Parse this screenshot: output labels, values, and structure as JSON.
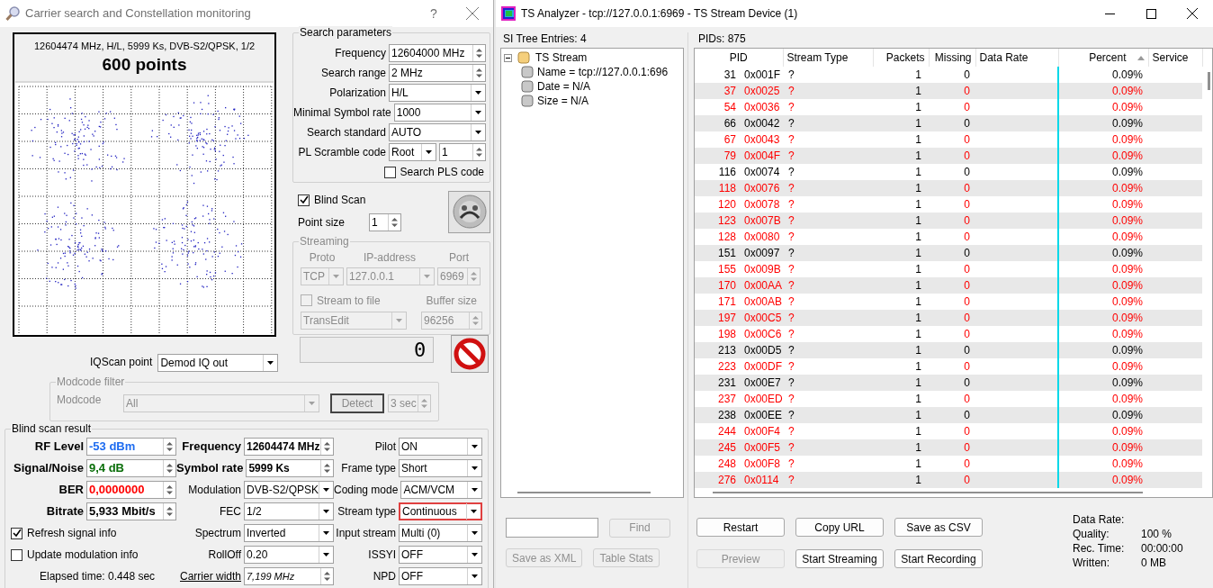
{
  "left_window": {
    "title": "Carrier search and Constellation monitoring",
    "help": "?",
    "constellation": {
      "info": "12604474 MHz, H/L, 5999 Ks, DVB-S2/QPSK, 1/2",
      "points_label": "600 points"
    },
    "search_parameters": {
      "title": "Search parameters",
      "fields": [
        {
          "label": "Frequency",
          "value": "12604000 MHz",
          "kind": "spin"
        },
        {
          "label": "Search range",
          "value": "2 MHz",
          "kind": "spin"
        },
        {
          "label": "Polarization",
          "value": "H/L",
          "kind": "combo"
        },
        {
          "label": "Minimal Symbol rate",
          "value": "1000",
          "kind": "combo"
        },
        {
          "label": "Search standard",
          "value": "AUTO",
          "kind": "combo"
        }
      ],
      "pl_scramble": {
        "label": "PL Scramble code",
        "mode": "Root",
        "value": "1"
      },
      "search_pls": {
        "label": "Search PLS code",
        "checked": false
      }
    },
    "blind_scan": {
      "label": "Blind Scan",
      "checked": true
    },
    "point_size": {
      "label": "Point size",
      "value": "1"
    },
    "streaming": {
      "title": "Streaming",
      "disabled": true,
      "proto_label": "Proto",
      "ip_label": "IP-address",
      "port_label": "Port",
      "proto": "TCP",
      "ip": "127.0.0.1",
      "port": "6969",
      "stream_to_file": {
        "label": "Stream to file",
        "checked": false
      },
      "buffer_label": "Buffer size",
      "target": "TransEdit",
      "buffer": "96256"
    },
    "counter": "0",
    "iq_scan": {
      "label": "IQScan point",
      "value": "Demod IQ out"
    },
    "modcode_filter": {
      "title": "Modcode filter",
      "disabled": true,
      "label": "Modcode",
      "value": "All",
      "detect": "Detect",
      "duration": "3 sec"
    },
    "blind_scan_result": {
      "title": "Blind scan result",
      "metrics": [
        {
          "label": "RF Level",
          "value": "-53 dBm",
          "color": "#1e6cf0"
        },
        {
          "label": "Signal/Noise",
          "value": "9,4 dB",
          "color": "#0a6e0a"
        },
        {
          "label": "BER",
          "value": "0,0000000",
          "color": "#ff0000"
        },
        {
          "label": "Bitrate",
          "value": "5,933 Mbit/s",
          "color": "#000000"
        }
      ],
      "checks": [
        {
          "label": "Refresh signal info",
          "checked": true
        },
        {
          "label": "Update modulation info",
          "checked": false
        }
      ],
      "elapsed": "Elapsed time: 0.448 sec",
      "params": [
        {
          "label": "Frequency",
          "value": "12604474 MHz",
          "kind": "bold-spin"
        },
        {
          "label": "Symbol rate",
          "value": "5999 Ks",
          "kind": "bold-spin"
        },
        {
          "label": "Modulation",
          "value": "DVB-S2/QPSK",
          "kind": "combo"
        },
        {
          "label": "FEC",
          "value": "1/2",
          "kind": "combo"
        },
        {
          "label": "Spectrum",
          "value": "Inverted",
          "kind": "combo"
        },
        {
          "label": "RollOff",
          "value": "0.20",
          "kind": "combo"
        },
        {
          "label": "Carrier width",
          "value": "7,199 MHz",
          "kind": "link-spin"
        }
      ],
      "options": [
        {
          "label": "Pilot",
          "value": "ON",
          "highlighted": false
        },
        {
          "label": "Frame type",
          "value": "Short",
          "highlighted": false
        },
        {
          "label": "Coding mode",
          "value": "ACM/VCM",
          "highlighted": false
        },
        {
          "label": "Stream type",
          "value": "Continuous",
          "highlighted": true
        },
        {
          "label": "Input stream",
          "value": "Multi (0)",
          "highlighted": false
        },
        {
          "label": "ISSYI",
          "value": "OFF",
          "highlighted": false
        },
        {
          "label": "NPD",
          "value": "OFF",
          "highlighted": false
        }
      ]
    }
  },
  "right_window": {
    "title": "TS Analyzer - tcp://127.0.0.1:6969 - TS Stream Device (1)",
    "tree": {
      "title": "SI Tree Entries: 4",
      "root": {
        "label": "TS Stream",
        "expanded": true,
        "children": [
          {
            "label": "Name = tcp://127.0.0.1:696"
          },
          {
            "label": "Date = N/A"
          },
          {
            "label": "Size = N/A"
          }
        ]
      }
    },
    "pids": {
      "title": "PIDs: 875",
      "columns": [
        {
          "label": "PID",
          "sorted": false
        },
        {
          "label": "Stream Type",
          "sorted": false
        },
        {
          "label": "Packets",
          "sorted": false
        },
        {
          "label": "Missing",
          "sorted": false
        },
        {
          "label": "Data Rate",
          "sorted": false
        },
        {
          "label": "Percent",
          "sorted": true
        },
        {
          "label": "Service",
          "sorted": false
        }
      ],
      "rows": [
        {
          "pid": "31",
          "hex": "0x001F",
          "type": "?",
          "packets": "1",
          "missing": "0",
          "percent": "0.09%",
          "error": false
        },
        {
          "pid": "37",
          "hex": "0x0025",
          "type": "?",
          "packets": "1",
          "missing": "0",
          "percent": "0.09%",
          "error": true
        },
        {
          "pid": "54",
          "hex": "0x0036",
          "type": "?",
          "packets": "1",
          "missing": "0",
          "percent": "0.09%",
          "error": true
        },
        {
          "pid": "66",
          "hex": "0x0042",
          "type": "?",
          "packets": "1",
          "missing": "0",
          "percent": "0.09%",
          "error": false
        },
        {
          "pid": "67",
          "hex": "0x0043",
          "type": "?",
          "packets": "1",
          "missing": "0",
          "percent": "0.09%",
          "error": true
        },
        {
          "pid": "79",
          "hex": "0x004F",
          "type": "?",
          "packets": "1",
          "missing": "0",
          "percent": "0.09%",
          "error": true
        },
        {
          "pid": "116",
          "hex": "0x0074",
          "type": "?",
          "packets": "1",
          "missing": "0",
          "percent": "0.09%",
          "error": false
        },
        {
          "pid": "118",
          "hex": "0x0076",
          "type": "?",
          "packets": "1",
          "missing": "0",
          "percent": "0.09%",
          "error": true
        },
        {
          "pid": "120",
          "hex": "0x0078",
          "type": "?",
          "packets": "1",
          "missing": "0",
          "percent": "0.09%",
          "error": true
        },
        {
          "pid": "123",
          "hex": "0x007B",
          "type": "?",
          "packets": "1",
          "missing": "0",
          "percent": "0.09%",
          "error": true
        },
        {
          "pid": "128",
          "hex": "0x0080",
          "type": "?",
          "packets": "1",
          "missing": "0",
          "percent": "0.09%",
          "error": true
        },
        {
          "pid": "151",
          "hex": "0x0097",
          "type": "?",
          "packets": "1",
          "missing": "0",
          "percent": "0.09%",
          "error": false
        },
        {
          "pid": "155",
          "hex": "0x009B",
          "type": "?",
          "packets": "1",
          "missing": "0",
          "percent": "0.09%",
          "error": true
        },
        {
          "pid": "170",
          "hex": "0x00AA",
          "type": "?",
          "packets": "1",
          "missing": "0",
          "percent": "0.09%",
          "error": true
        },
        {
          "pid": "171",
          "hex": "0x00AB",
          "type": "?",
          "packets": "1",
          "missing": "0",
          "percent": "0.09%",
          "error": true
        },
        {
          "pid": "197",
          "hex": "0x00C5",
          "type": "?",
          "packets": "1",
          "missing": "0",
          "percent": "0.09%",
          "error": true
        },
        {
          "pid": "198",
          "hex": "0x00C6",
          "type": "?",
          "packets": "1",
          "missing": "0",
          "percent": "0.09%",
          "error": true
        },
        {
          "pid": "213",
          "hex": "0x00D5",
          "type": "?",
          "packets": "1",
          "missing": "0",
          "percent": "0.09%",
          "error": false
        },
        {
          "pid": "223",
          "hex": "0x00DF",
          "type": "?",
          "packets": "1",
          "missing": "0",
          "percent": "0.09%",
          "error": true
        },
        {
          "pid": "231",
          "hex": "0x00E7",
          "type": "?",
          "packets": "1",
          "missing": "0",
          "percent": "0.09%",
          "error": false
        },
        {
          "pid": "237",
          "hex": "0x00ED",
          "type": "?",
          "packets": "1",
          "missing": "0",
          "percent": "0.09%",
          "error": true
        },
        {
          "pid": "238",
          "hex": "0x00EE",
          "type": "?",
          "packets": "1",
          "missing": "0",
          "percent": "0.09%",
          "error": false
        },
        {
          "pid": "244",
          "hex": "0x00F4",
          "type": "?",
          "packets": "1",
          "missing": "0",
          "percent": "0.09%",
          "error": true
        },
        {
          "pid": "245",
          "hex": "0x00F5",
          "type": "?",
          "packets": "1",
          "missing": "0",
          "percent": "0.09%",
          "error": true
        },
        {
          "pid": "248",
          "hex": "0x00F8",
          "type": "?",
          "packets": "1",
          "missing": "0",
          "percent": "0.09%",
          "error": true
        },
        {
          "pid": "276",
          "hex": "0x0114",
          "type": "?",
          "packets": "1",
          "missing": "0",
          "percent": "0.09%",
          "error": true
        }
      ]
    },
    "find": {
      "button": "Find",
      "disabled": true
    },
    "tree_buttons": [
      {
        "label": "Save as XML",
        "disabled": true
      },
      {
        "label": "Table Stats",
        "disabled": true
      }
    ],
    "buttons": [
      {
        "label": "Restart",
        "disabled": false
      },
      {
        "label": "Copy URL",
        "disabled": false
      },
      {
        "label": "Save as CSV",
        "disabled": false
      },
      {
        "label": "Preview",
        "disabled": true
      },
      {
        "label": "Start Streaming",
        "disabled": false
      },
      {
        "label": "Start Recording",
        "disabled": false
      }
    ],
    "stats": [
      {
        "label": "Data Rate:"
      },
      {
        "label": "Quality:",
        "value": "100 %"
      },
      {
        "label": "Rec. Time:",
        "value": "00:00:00"
      },
      {
        "label": "Written:",
        "value": "0 MB"
      }
    ]
  }
}
